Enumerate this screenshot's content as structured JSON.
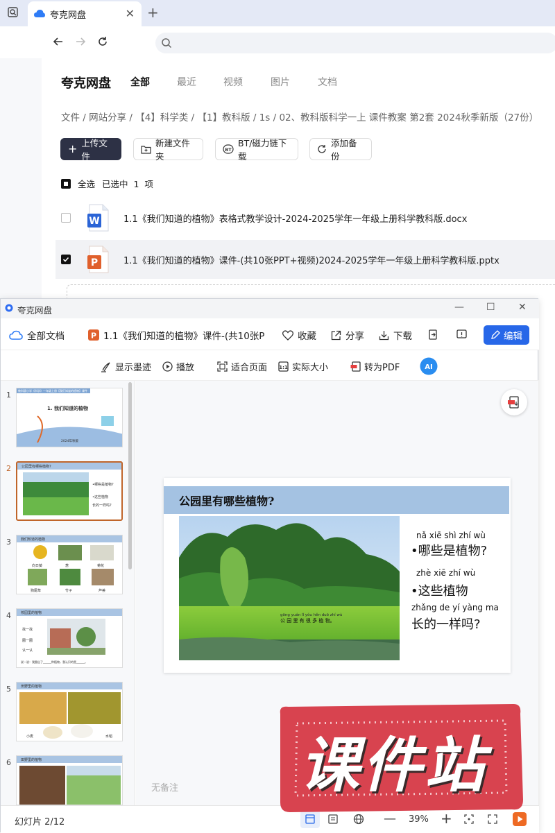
{
  "browser": {
    "tab_title": "夸克网盘"
  },
  "pan": {
    "brand": "夸克网盘",
    "tabs": [
      "全部",
      "最近",
      "视频",
      "图片",
      "文档"
    ],
    "breadcrumb": "文件 / 网站分享 / 【4】科学类 / 【1】教科版 / 1s / 02、教科版科学一上 课件教案 第2套 2024秋季新版（27份）",
    "actions": {
      "upload": "上传文件",
      "new_folder": "新建文件夹",
      "bt": "BT/磁力链下载",
      "backup": "添加备份"
    },
    "select_all": "全选",
    "selected_text": "已选中  1  项",
    "files": [
      {
        "name": "1.1《我们知道的植物》表格式教学设计-2024-2025学年一年级上册科学教科版.docx",
        "type": "docx",
        "checked": false
      },
      {
        "name": "1.1《我们知道的植物》课件-(共10张PPT+视频)2024-2025学年一年级上册科学教科版.pptx",
        "type": "pptx",
        "checked": true
      }
    ]
  },
  "viewer": {
    "window_title": "夸克网盘",
    "all_docs": "全部文档",
    "doc_title": "1.1《我们知道的植物》课件-(共10张P",
    "favorite": "收藏",
    "share": "分享",
    "download": "下载",
    "edit": "编辑",
    "toolbar": {
      "ink": "显示墨迹",
      "play": "播放",
      "fit": "适合页面",
      "actual": "实际大小",
      "to_pdf": "转为PDF"
    },
    "thumbnails": [
      {
        "num": "1",
        "title": "1. 我们知道的植物",
        "year": "2024年秋版",
        "school": "教科版小学《科学》一年级上册【我们知道的植物】课件"
      },
      {
        "num": "2",
        "title": "公园里有哪些植物?",
        "lines": [
          "•哪些是植物?",
          "•这些植物",
          "长的一样吗?"
        ]
      },
      {
        "num": "3",
        "title": "我们知道的植物",
        "labels": [
          "向日葵",
          "葱",
          "菊花",
          "狗尾草",
          "竹子",
          "芦荟"
        ]
      },
      {
        "num": "4",
        "title": "校园里的植物",
        "labels": [
          "找一找",
          "圈一圈",
          "认一认"
        ],
        "footer": "说一说：我圈出了______种植物，我认识的是______。"
      },
      {
        "num": "5",
        "title": "田野里的植物",
        "labels": [
          "小麦",
          "水稻"
        ]
      },
      {
        "num": "6",
        "title": "田野里的植物"
      }
    ],
    "slide": {
      "title": "公园里有哪些植物?",
      "photo_caption_pinyin": "gōng yuán lǐ yǒu hěn duō zhí wù",
      "photo_caption": "公 园 里 有 很 多 植 物。",
      "lines": [
        {
          "pinyin": "nǎ xiē shì zhí wù",
          "text": "•哪些是植物?"
        },
        {
          "pinyin": "zhè xiē zhí wù",
          "text": "•这些植物"
        },
        {
          "pinyin": "zhǎng de yí yàng ma",
          "text": "长的一样吗?"
        }
      ]
    },
    "no_notes": "无备注",
    "slide_count": "幻灯片 2/12",
    "zoom": "39%"
  },
  "watermark": "课件站",
  "colors": {
    "accent": "#2767e8",
    "upload_btn": "#2d3145",
    "slide_header": "#a4c2e2",
    "selected_thumb": "#c0652a",
    "watermark": "#d8434f"
  }
}
